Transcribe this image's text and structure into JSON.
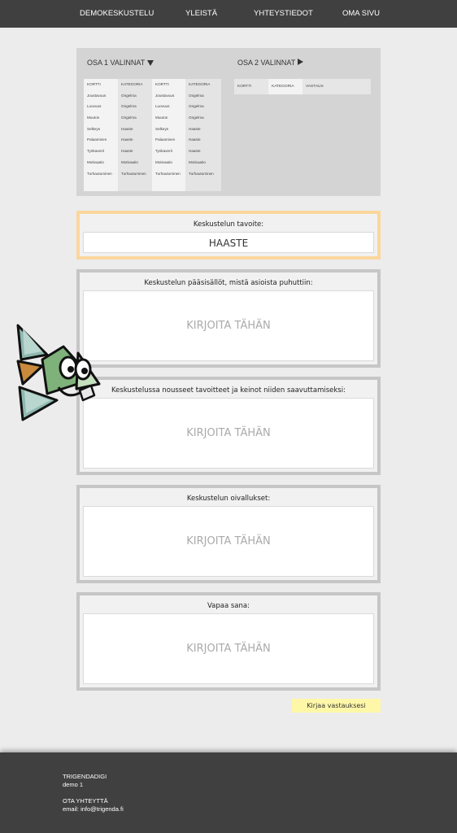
{
  "nav": {
    "items": [
      "DEMOKESKUSTELU",
      "YLEISTÄ",
      "YHTEYSTIEDOT",
      "OMA SIVU"
    ]
  },
  "osa1": {
    "title": "OSA 1 VALINNAT",
    "columns": [
      {
        "header": "KORTTI",
        "cells": [
          "Joustavuus",
          "Luovuus",
          "Muutos",
          "Selkeys",
          "Palaaminen",
          "Työkaverit",
          "Motivaatio",
          "Turhautuminen"
        ]
      },
      {
        "header": "KATEGORIA",
        "cells": [
          "Ongelma",
          "Ongelma",
          "Ongelma",
          "Haaste",
          "Haaste",
          "Haaste",
          "Motivaatio",
          "Turhautuminen"
        ]
      },
      {
        "header": "KORTTI",
        "cells": [
          "Joustavuus",
          "Luovuus",
          "Muutos",
          "Selkeys",
          "Palaaminen",
          "Työkaverit",
          "Motivaatio",
          "Turhautuminen"
        ]
      },
      {
        "header": "KATEGORIA",
        "cells": [
          "Ongelma",
          "Ongelma",
          "Ongelma",
          "Haaste",
          "Haaste",
          "Haaste",
          "Motivaatio",
          "Turhautuminen"
        ]
      }
    ]
  },
  "osa2": {
    "title": "OSA 2 VALINNAT",
    "headers": [
      "KORTTI",
      "KATEGORIA",
      "VASTAUS"
    ]
  },
  "goal": {
    "label": "Keskustelun tavoite:",
    "value": "HAASTE"
  },
  "sections": [
    {
      "label": "Keskustelun pääsisällöt, mistä asioista puhuttiin:",
      "placeholder": "KIRJOITA TÄHÄN"
    },
    {
      "label": "Keskustelussa nousseet tavoitteet ja keinot niiden saavuttamiseksi:",
      "placeholder": "KIRJOITA TÄHÄN"
    },
    {
      "label": "Keskustelun oivallukset:",
      "placeholder": "KIRJOITA TÄHÄN"
    },
    {
      "label": "Vapaa sana:",
      "placeholder": "KIRJOITA TÄHÄN"
    }
  ],
  "submit_label": "Kirjaa vastauksesi",
  "footer": {
    "org": "TRIGENDADIGI",
    "sub": "demo 1",
    "contact_title": "OTA YHTEYTTÄ",
    "email": "email: info@trigenda.fi"
  },
  "colors": {
    "nav_bg": "#404040",
    "page_bg": "#ececec",
    "goal_border": "#fbd69d",
    "section_border": "#c6c6c6",
    "submit_bg": "#fff7a8"
  },
  "mascot": {
    "icon": "trigenda-mascot-icon"
  }
}
